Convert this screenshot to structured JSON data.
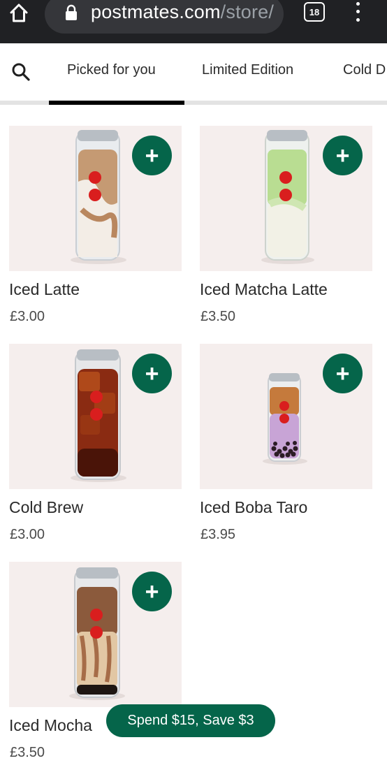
{
  "browser": {
    "url_main": "postmates.com",
    "url_path": "/store/a",
    "tab_count": "18"
  },
  "categories": [
    "Picked for you",
    "Limited Edition",
    "Cold D"
  ],
  "products": [
    {
      "name": "Iced Latte",
      "price": "£3.00"
    },
    {
      "name": "Iced Matcha Latte",
      "price": "£3.50"
    },
    {
      "name": "Cold Brew",
      "price": "£3.00"
    },
    {
      "name": "Iced Boba Taro",
      "price": "£3.95"
    },
    {
      "name": "Iced Mocha",
      "price": "£3.50"
    }
  ],
  "add_label": "+",
  "promo": "Spend $15, Save $3",
  "colors": {
    "brand_green": "#05654a",
    "marker_red": "#d91e1e",
    "card_background": "#f5eeed"
  },
  "icons": [
    "home-icon",
    "lock-icon",
    "tab-switcher-icon",
    "more-vert-icon",
    "search-icon"
  ]
}
